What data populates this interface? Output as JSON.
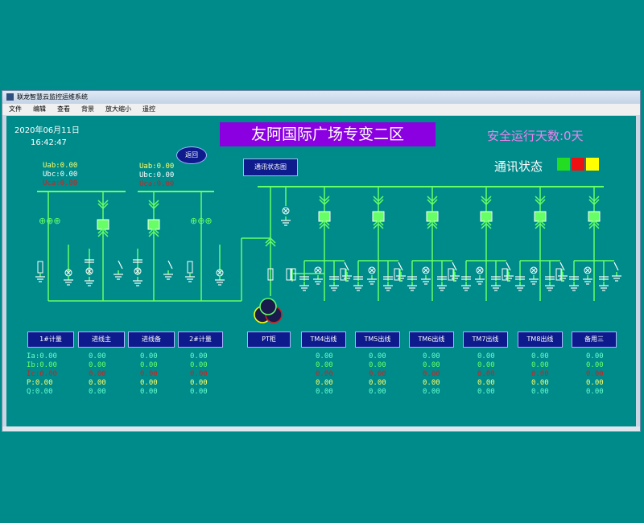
{
  "window": {
    "title": "联龙智慧云监控运维系统"
  },
  "menu": [
    "文件",
    "编辑",
    "查看",
    "背景",
    "放大缩小",
    "遥控"
  ],
  "header": {
    "date": "2020年06月11日",
    "time": "16:42:47",
    "title": "友阿国际广场专变二区",
    "safe_days": "安全运行天数:0天",
    "comm_label": "通讯状态",
    "comm_lamps": [
      "#22dd22",
      "#ee1111",
      "#ffff00"
    ]
  },
  "buttons": {
    "back": "返回",
    "comm_diagram": "通讯状态图"
  },
  "voltage_left": [
    "Uab:0.00",
    "Ubc:0.00",
    "Uca:0.00"
  ],
  "voltage_mid": [
    "Uab:0.00",
    "Ubc:0.00",
    "Uca:0.00"
  ],
  "feeders": [
    "1#计量",
    "进线主",
    "进线备",
    "2#计量",
    "PT柜",
    "TM4出线",
    "TM5出线",
    "TM6出线",
    "TM7出线",
    "TM8出线",
    "备用三"
  ],
  "meter_labels": [
    "Ia:0.00",
    "Ib:0.00",
    "Ic:0.00",
    "P:0.00",
    "Q:0.00"
  ],
  "meter_values": [
    "0.00",
    "0.00",
    "0.00",
    "0.00",
    "0.00"
  ],
  "colors": {
    "line": "#66ff66",
    "panel": "#008B8B",
    "button": "#0d1b8c"
  }
}
